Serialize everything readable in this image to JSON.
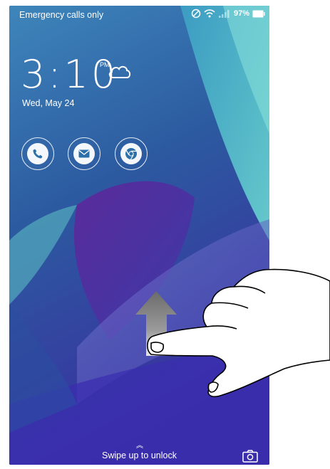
{
  "status_bar": {
    "carrier_text": "Emergency calls only",
    "battery_percent": "97%",
    "icons": [
      "do-not-disturb-icon",
      "wifi-icon",
      "signal-icon",
      "battery-icon"
    ]
  },
  "lock_screen": {
    "time": "3:10",
    "ampm": "PM",
    "date": "Wed, May 24",
    "weather_icon": "cloud-icon",
    "shortcuts": [
      {
        "name": "phone",
        "icon": "phone-icon"
      },
      {
        "name": "messages",
        "icon": "mail-icon"
      },
      {
        "name": "browser",
        "icon": "chrome-icon"
      }
    ],
    "swipe_hint": "Swipe up to unlock",
    "camera_icon": "camera-icon"
  },
  "gesture": {
    "direction": "up",
    "icons": [
      "up-arrow-icon",
      "hand-icon"
    ]
  },
  "colors": {
    "wallpaper_blue": "#2c4a8e",
    "wallpaper_teal": "#57c7c9",
    "wallpaper_purple": "#5b2c92",
    "shortcut_icon": "#2d6fa8",
    "text": "#ffffff"
  }
}
